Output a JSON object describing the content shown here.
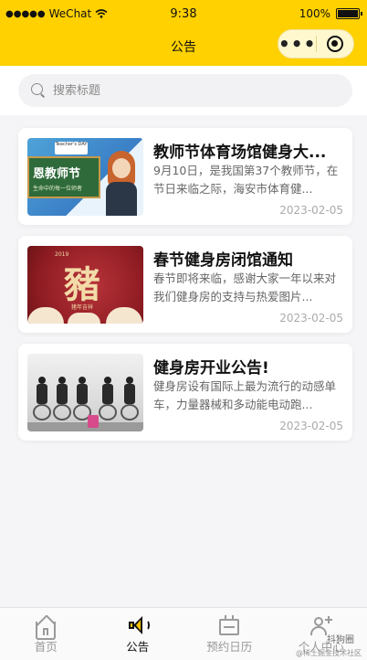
{
  "status_bar": {
    "signal": "●●●●●",
    "carrier": "WeChat",
    "wifi_icon": "wifi-icon",
    "time": "9:38",
    "battery_percent": "100%"
  },
  "nav": {
    "title": "公告",
    "more_icon": "•••",
    "capsule_icon": "target-icon"
  },
  "search": {
    "placeholder": "搜索标题"
  },
  "announcements": [
    {
      "title": "教师节体育场馆健身大...",
      "desc": "9月10日，是我国第37个教师节，在节日来临之际，海安市体育健...",
      "date": "2023-02-05",
      "thumb_board_text": "恩教师节",
      "thumb_board_sub": "生命中的每一位师者",
      "thumb_sign": "Teacher's DAY"
    },
    {
      "title": "春节健身房闭馆通知",
      "desc": "春节即将来临，感谢大家一年以来对我们健身房的支持与热爱图片...",
      "date": "2023-02-05",
      "thumb_char": "豬",
      "thumb_caption": "猪年吉祥",
      "thumb_year": "2019"
    },
    {
      "title": "健身房开业公告!",
      "desc": "健身房设有国际上最为流行的动感单车，力量器械和多动能电动跑...",
      "date": "2023-02-05"
    }
  ],
  "tabs": [
    {
      "label": "首页",
      "icon": "home-icon",
      "active": false
    },
    {
      "label": "公告",
      "icon": "speaker-icon",
      "active": true
    },
    {
      "label": "预约日历",
      "icon": "calendar-icon",
      "active": false
    },
    {
      "label": "个人中心",
      "icon": "user-add-icon",
      "active": false
    }
  ],
  "watermark": {
    "line1": "抖狗圈",
    "line2": "@稀土掘金技术社区"
  },
  "colors": {
    "theme_yellow": "#ffd100",
    "page_bg": "#f5f5f7"
  }
}
